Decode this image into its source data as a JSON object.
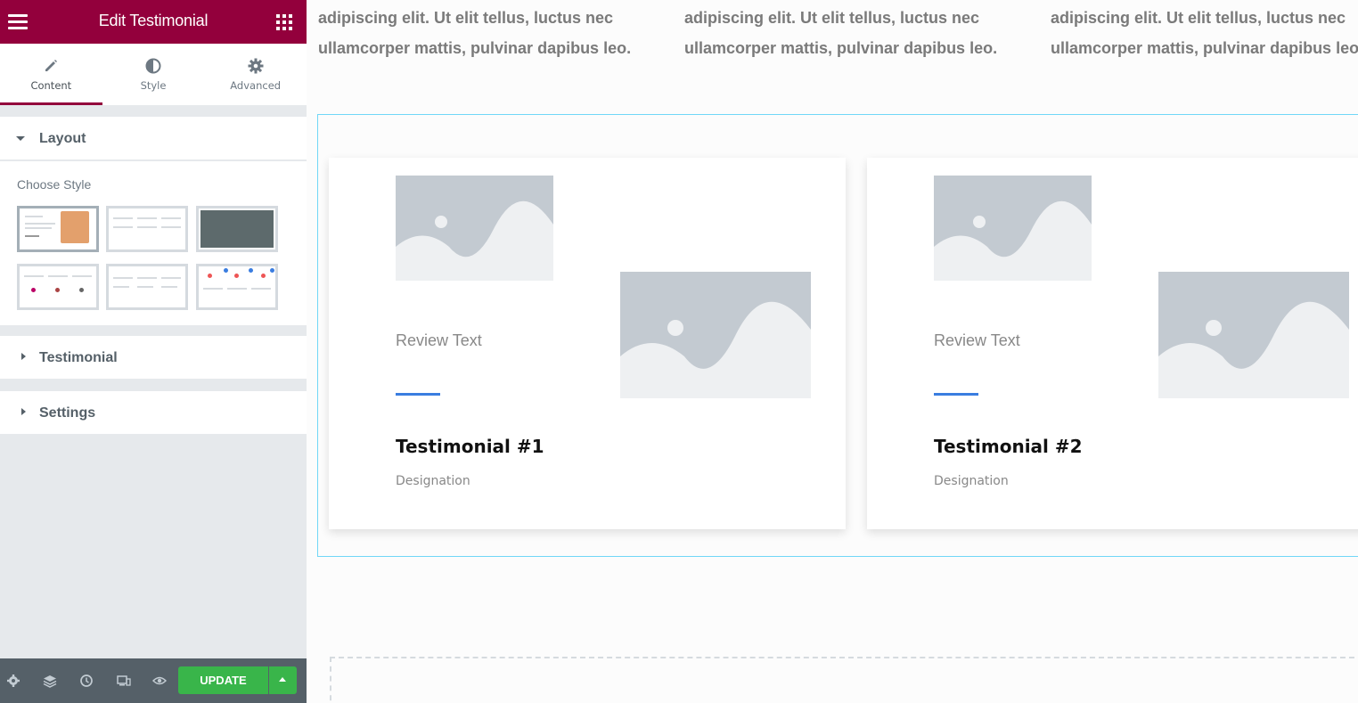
{
  "panel": {
    "title": "Edit Testimonial",
    "tabs": [
      {
        "label": "Content",
        "icon": "pencil-icon",
        "active": true
      },
      {
        "label": "Style",
        "icon": "half-circle-icon",
        "active": false
      },
      {
        "label": "Advanced",
        "icon": "gear-icon",
        "active": false
      }
    ],
    "sections": {
      "layout": "Layout",
      "testimonial": "Testimonial",
      "settings": "Settings"
    },
    "choose_style": "Choose Style",
    "style_presets": [
      "preset-1",
      "preset-2",
      "preset-3",
      "preset-4",
      "preset-5",
      "preset-6"
    ],
    "selected_preset": "preset-1"
  },
  "footer": {
    "update_label": "UPDATE",
    "icons": [
      "settings-icon",
      "layers-icon",
      "history-icon",
      "responsive-icon",
      "preview-eye-icon"
    ]
  },
  "canvas": {
    "columns": [
      {
        "line1": "adipiscing elit. Ut elit tellus, luctus nec",
        "line2": "ullamcorper mattis, pulvinar dapibus leo."
      },
      {
        "line1": "adipiscing elit. Ut elit tellus, luctus nec",
        "line2": "ullamcorper mattis, pulvinar dapibus leo."
      },
      {
        "line1": "adipiscing elit. Ut elit tellus, luctus nec",
        "line2": "ullamcorper mattis, pulvinar dapibus leo."
      }
    ],
    "testimonials": [
      {
        "review": "Review Text",
        "name": "Testimonial #1",
        "designation": "Designation"
      },
      {
        "review": "Review Text",
        "name": "Testimonial #2",
        "designation": "Designation"
      }
    ]
  },
  "colors": {
    "brand": "#93003c",
    "update_green": "#39b54a",
    "accent_blue": "#3a7de0",
    "frame_cyan": "#71d7f7"
  }
}
